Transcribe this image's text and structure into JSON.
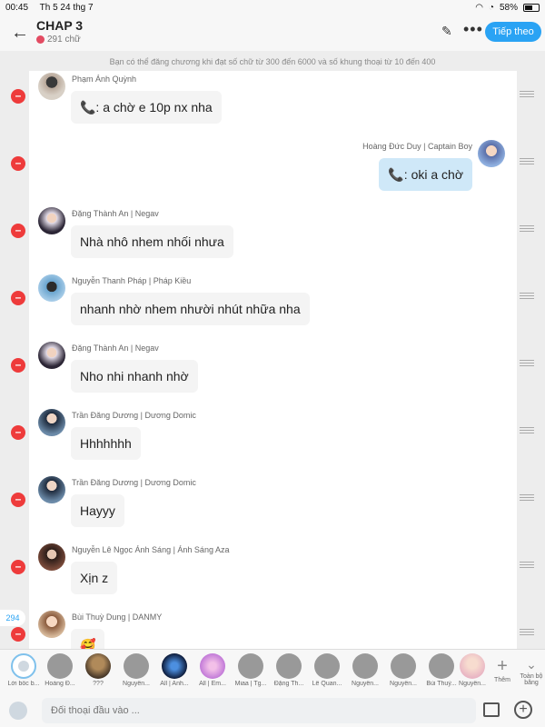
{
  "status_bar": {
    "time": "00:45",
    "date": "Th 5 24 thg 7",
    "battery": "58%"
  },
  "header": {
    "title": "CHAP 3",
    "word_count": "291 chữ",
    "continue_label": "Tiếp theo"
  },
  "notice": "Bạn có thể đăng chương khi đạt số chữ từ 300 đến 6000 và số khung thoại từ 10 đến 400",
  "messages": [
    {
      "name": "Phạm Ánh Quỳnh",
      "text": "📞: a chờ e 10p nx nha",
      "side": "left"
    },
    {
      "name": "Hoàng Đức Duy | Captain Boy",
      "text": "📞: oki a chờ",
      "side": "right"
    },
    {
      "name": "Đặng Thành An | Negav",
      "text": "Nhà nhô nhem nhối nhưa",
      "side": "left"
    },
    {
      "name": "Nguyễn Thanh Pháp | Pháp Kiều",
      "text": "nhanh nhờ nhem nhười nhút nhữa nha",
      "side": "left"
    },
    {
      "name": "Đặng Thành An | Negav",
      "text": "Nho nhi nhanh nhờ",
      "side": "left"
    },
    {
      "name": "Trần Đăng Dương | Dương Domic",
      "text": "Hhhhhhh",
      "side": "left"
    },
    {
      "name": "Trần Đăng Dương | Dương Domic",
      "text": "Hayyy",
      "side": "left"
    },
    {
      "name": "Nguyễn Lê Ngọc Ánh Sáng | Ánh Sáng Aza",
      "text": "Xịn z",
      "side": "left"
    },
    {
      "name": "Bùi Thuỳ Dung | DANMY",
      "text": "🥰",
      "side": "left"
    }
  ],
  "frame_count": "294",
  "characters": [
    "Lời bốc b...",
    "Hoàng Đ...",
    "???",
    "Nguyễn...",
    "All | Anh...",
    "All | Em...",
    "Miaa | Tg...",
    "Đặng Th...",
    "Lê Quan...",
    "Nguyễn...",
    "Nguyễn...",
    "Bùi Thuỳ...",
    "Nguyễn..."
  ],
  "add_label": "Thêm",
  "all_label": "Toàn bộ băng",
  "input": {
    "placeholder": "Đối thoại đầu vào ..."
  }
}
